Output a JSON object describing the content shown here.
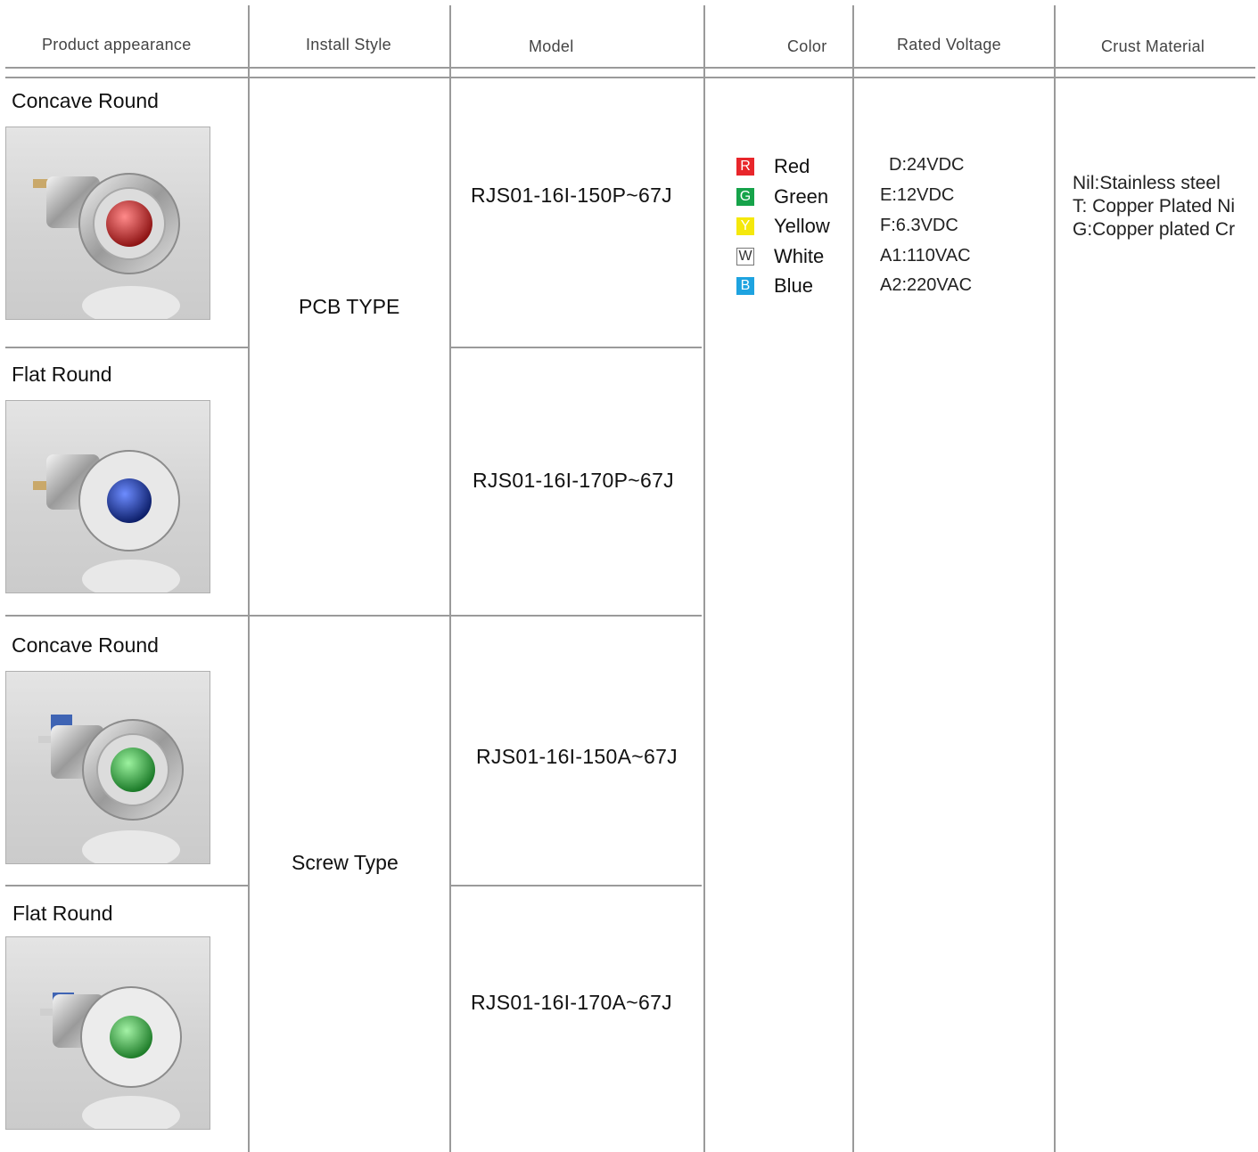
{
  "headers": {
    "appearance": "Product appearance",
    "install": "Install Style",
    "model": "Model",
    "color": "Color",
    "voltage": "Rated Voltage",
    "crust": "Crust Material"
  },
  "products": [
    {
      "label": "Concave Round",
      "lens_color": "#c8282a",
      "lens_name": "red-lens"
    },
    {
      "label": "Flat Round",
      "lens_color": "#1d3fa6",
      "lens_name": "blue-lens"
    },
    {
      "label": "Concave Round",
      "lens_color": "#2fa83c",
      "lens_name": "green-lens"
    },
    {
      "label": "Flat Round",
      "lens_color": "#35a63a",
      "lens_name": "green-lens"
    }
  ],
  "install_styles": [
    "PCB TYPE",
    "Screw Type"
  ],
  "models": [
    "RJS01-16I-150P~67J",
    "RJS01-16I-170P~67J",
    "RJS01-16I-150A~67J",
    "RJS01-16I-170A~67J"
  ],
  "colors": [
    {
      "code": "R",
      "name": "Red",
      "swatch": "#e8262b"
    },
    {
      "code": "G",
      "name": "Green",
      "swatch": "#16a34a"
    },
    {
      "code": "Y",
      "name": "Yellow",
      "swatch": "#f5e80c"
    },
    {
      "code": "W",
      "name": "White",
      "swatch": "#ffffff"
    },
    {
      "code": "B",
      "name": "Blue",
      "swatch": "#1ea3e0"
    }
  ],
  "voltages": [
    "D:24VDC",
    "E:12VDC",
    "F:6.3VDC",
    "A1:110VAC",
    "A2:220VAC"
  ],
  "crust_materials": [
    "Nil:Stainless steel",
    "T: Copper Plated Ni",
    "G:Copper plated Cr"
  ]
}
